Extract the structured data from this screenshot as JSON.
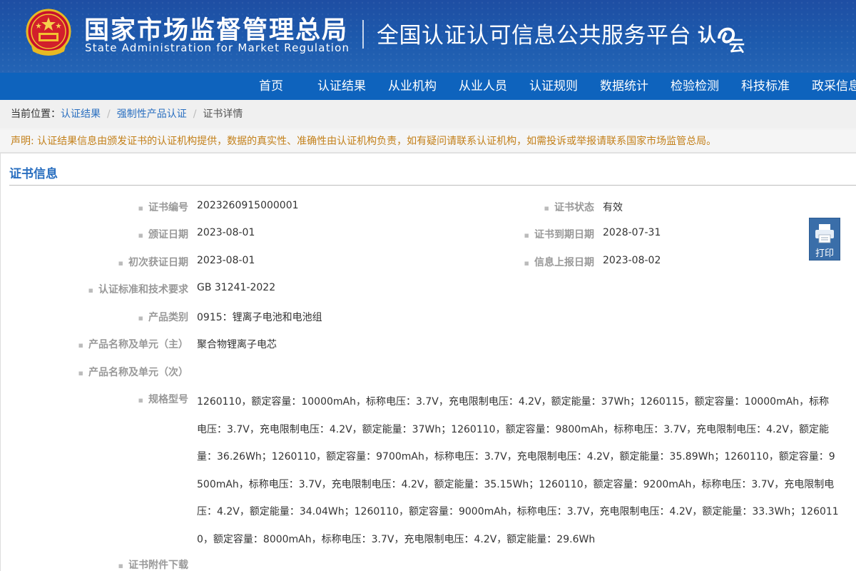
{
  "header": {
    "agency_cn": "国家市场监督管理总局",
    "agency_en": "State Administration  for  Market Regulation",
    "platform_title": "全国认证认可信息公共服务平台",
    "platform_logo_text": "认e云",
    "bg_color": "#1d5aad"
  },
  "nav": {
    "items": [
      "首页",
      "认证结果",
      "从业机构",
      "从业人员",
      "认证规则",
      "数据统计",
      "检验检测",
      "科技标准",
      "政采信息"
    ],
    "bg_color": "#0e63bd"
  },
  "breadcrumb": {
    "prefix": "当前位置：",
    "items": [
      "认证结果",
      "强制性产品认证"
    ],
    "current": "证书详情",
    "separator": "/"
  },
  "notice": "声明: 认证结果信息由颁发证书的认证机构提供，数据的真实性、准确性由认证机构负责，如有疑问请联系认证机构，如需投诉或举报请联系国家市场监管总局。",
  "section_title": "证书信息",
  "fields": {
    "cert_no": {
      "label": "证书编号",
      "value": "2023260915000001"
    },
    "cert_status": {
      "label": "证书状态",
      "value": "有效"
    },
    "issue_date": {
      "label": "颁证日期",
      "value": "2023-08-01"
    },
    "expire_date": {
      "label": "证书到期日期",
      "value": "2028-07-31"
    },
    "first_date": {
      "label": "初次获证日期",
      "value": "2023-08-01"
    },
    "report_date": {
      "label": "信息上报日期",
      "value": "2023-08-02"
    },
    "standard": {
      "label": "认证标准和技术要求",
      "value": "GB 31241-2022"
    },
    "category": {
      "label": "产品类别",
      "value": "0915：锂离子电池和电池组"
    },
    "product_main": {
      "label": "产品名称及单元（主）",
      "value": "聚合物锂离子电芯"
    },
    "product_sub": {
      "label": "产品名称及单元（次）",
      "value": ""
    },
    "spec": {
      "label": "规格型号",
      "value": "1260110，额定容量：10000mAh，标称电压：3.7V，充电限制电压：4.2V，额定能量：37Wh；1260115，额定容量：10000mAh，标称电压：3.7V，充电限制电压：4.2V，额定能量：37Wh；1260110，额定容量：9800mAh，标称电压：3.7V，充电限制电压：4.2V，额定能量：36.26Wh；1260110，额定容量：9700mAh，标称电压：3.7V，充电限制电压：4.2V，额定能量：35.89Wh；1260110，额定容量：9500mAh，标称电压：3.7V，充电限制电压：4.2V，额定能量：35.15Wh；1260110，额定容量：9200mAh，标称电压：3.7V，充电限制电压：4.2V，额定能量：34.04Wh；1260110，额定容量：9000mAh，标称电压：3.7V，充电限制电压：4.2V，额定能量：33.3Wh；1260110，额定容量：8000mAh，标称电压：3.7V，充电限制电压：4.2V，额定能量：29.6Wh"
    },
    "attachments": {
      "label": "证书附件下载",
      "value": ""
    }
  },
  "print_button": {
    "label": "打印",
    "icon": "printer-icon"
  },
  "colors": {
    "accent": "#2a6fc0",
    "notice": "#c3801a",
    "label": "#999999"
  }
}
